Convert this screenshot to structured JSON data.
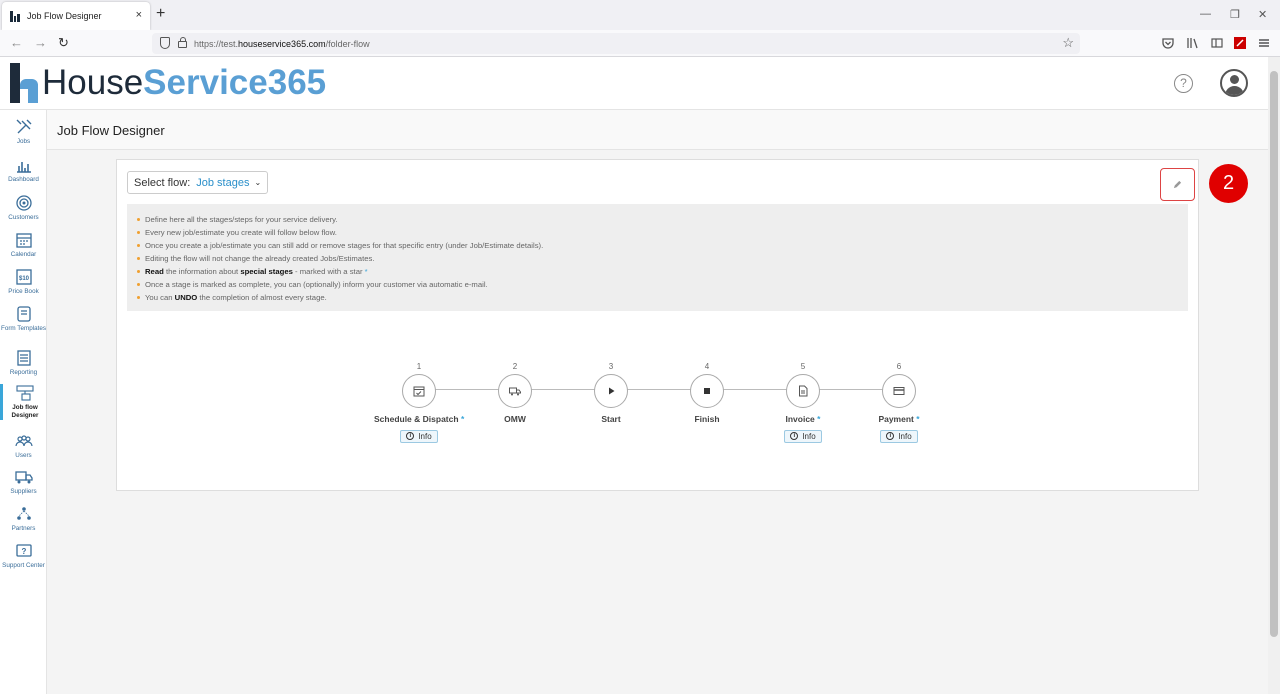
{
  "browser": {
    "tab_title": "Job Flow Designer",
    "tab_close": "×",
    "new_tab": "+",
    "url_prefix": "https://test.",
    "url_host": "houseservice365.com",
    "url_path": "/folder-flow",
    "win_minimize": "—",
    "win_restore": "❐",
    "win_close": "✕"
  },
  "header": {
    "logo_part1": "House",
    "logo_part2": "Service365",
    "help_symbol": "?"
  },
  "sidebar": {
    "items": [
      {
        "label": "Jobs",
        "icon": "tools-icon"
      },
      {
        "label": "Dashboard",
        "icon": "bar-chart-icon"
      },
      {
        "label": "Customers",
        "icon": "target-icon"
      },
      {
        "label": "Calendar",
        "icon": "calendar-icon"
      },
      {
        "label": "Price Book",
        "icon": "price-tag-icon"
      },
      {
        "label": "Form Templates",
        "icon": "form-icon"
      },
      {
        "label": "Reporting",
        "icon": "report-icon"
      },
      {
        "label": "Job flow Designer",
        "icon": "flow-icon"
      },
      {
        "label": "Users",
        "icon": "users-icon"
      },
      {
        "label": "Suppliers",
        "icon": "truck-icon"
      },
      {
        "label": "Partners",
        "icon": "partners-icon"
      },
      {
        "label": "Support Center",
        "icon": "support-icon"
      }
    ]
  },
  "page": {
    "title": "Job Flow Designer",
    "select_label": "Select flow:",
    "select_value": "Job stages"
  },
  "info": {
    "line1": "Define here all the stages/steps for your service delivery.",
    "line2": "Every new job/estimate you create will follow below flow.",
    "line3": "Once you create a job/estimate you can still add or remove stages for that specific entry (under Job/Estimate details).",
    "line4": "Editing the flow will not change the already created Jobs/Estimates.",
    "line5_a": "Read",
    "line5_b": " the information about ",
    "line5_c": "special stages",
    "line5_d": " - marked with a star ",
    "line5_star": "*",
    "line6": "Once a stage is marked as complete, you can (optionally) inform your customer via automatic e-mail.",
    "line7_a": "You can ",
    "line7_b": "UNDO",
    "line7_c": " the completion of almost every stage."
  },
  "stages": [
    {
      "num": "1",
      "name": "Schedule & Dispatch",
      "star": "*",
      "info": "Info",
      "icon": "calendar-check-icon"
    },
    {
      "num": "2",
      "name": "OMW",
      "star": "",
      "info": "",
      "icon": "truck-icon"
    },
    {
      "num": "3",
      "name": "Start",
      "star": "",
      "info": "",
      "icon": "play-icon"
    },
    {
      "num": "4",
      "name": "Finish",
      "star": "",
      "info": "",
      "icon": "stop-icon"
    },
    {
      "num": "5",
      "name": "Invoice",
      "star": "*",
      "info": "Info",
      "icon": "document-icon"
    },
    {
      "num": "6",
      "name": "Payment",
      "star": "*",
      "info": "Info",
      "icon": "card-icon"
    }
  ],
  "annotation_badge": "2",
  "colors": {
    "accent": "#3aa6d9",
    "brand_dark": "#1e2b3a",
    "brand_light": "#5a9fd4",
    "badge": "#e00000"
  }
}
